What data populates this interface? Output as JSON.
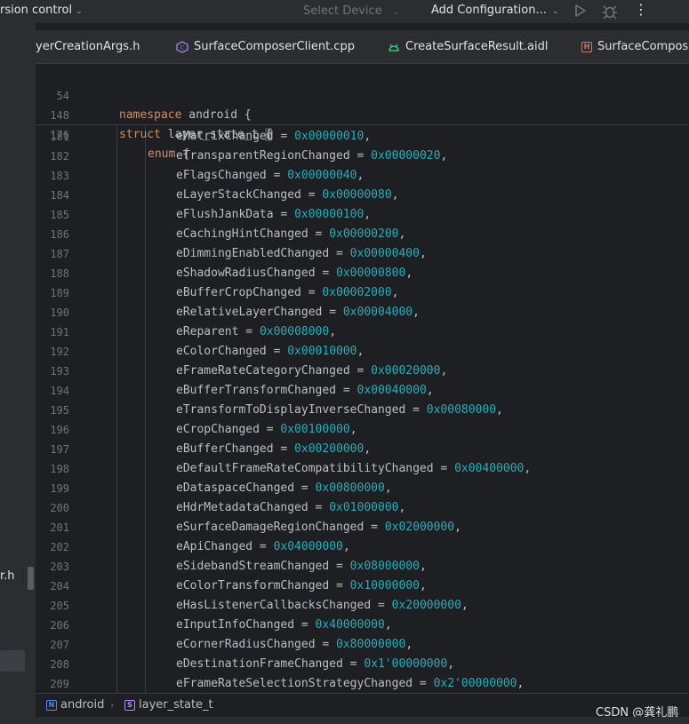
{
  "toolbar": {
    "version_control": "rsion control",
    "select_device": "Select Device",
    "add_configuration": "Add Configuration..."
  },
  "left_panel": {
    "file_fragment": "r.h"
  },
  "tabs": [
    {
      "label": "yerCreationArgs.h"
    },
    {
      "label": "SurfaceComposerClient.cpp"
    },
    {
      "label": "CreateSurfaceResult.aidl"
    },
    {
      "label": "SurfaceCompose"
    }
  ],
  "sticky": [
    {
      "line": "54",
      "kw": "namespace",
      "rest": " android {"
    },
    {
      "line": "148",
      "kw": "struct",
      "rest": " layer_state_t "
    },
    {
      "line": "176",
      "kw": "enum",
      "rest": " "
    }
  ],
  "code_lines": [
    {
      "line": "181",
      "name": "eMatrixChanged",
      "value": "0x00000010"
    },
    {
      "line": "182",
      "name": "eTransparentRegionChanged",
      "value": "0x00000020"
    },
    {
      "line": "183",
      "name": "eFlagsChanged",
      "value": "0x00000040"
    },
    {
      "line": "184",
      "name": "eLayerStackChanged",
      "value": "0x00000080"
    },
    {
      "line": "185",
      "name": "eFlushJankData",
      "value": "0x00000100"
    },
    {
      "line": "186",
      "name": "eCachingHintChanged",
      "value": "0x00000200"
    },
    {
      "line": "187",
      "name": "eDimmingEnabledChanged",
      "value": "0x00000400"
    },
    {
      "line": "188",
      "name": "eShadowRadiusChanged",
      "value": "0x00000800"
    },
    {
      "line": "189",
      "name": "eBufferCropChanged",
      "value": "0x00002000"
    },
    {
      "line": "190",
      "name": "eRelativeLayerChanged",
      "value": "0x00004000"
    },
    {
      "line": "191",
      "name": "eReparent",
      "value": "0x00008000"
    },
    {
      "line": "192",
      "name": "eColorChanged",
      "value": "0x00010000"
    },
    {
      "line": "193",
      "name": "eFrameRateCategoryChanged",
      "value": "0x00020000"
    },
    {
      "line": "194",
      "name": "eBufferTransformChanged",
      "value": "0x00040000"
    },
    {
      "line": "195",
      "name": "eTransformToDisplayInverseChanged",
      "value": "0x00080000"
    },
    {
      "line": "196",
      "name": "eCropChanged",
      "value": "0x00100000"
    },
    {
      "line": "197",
      "name": "eBufferChanged",
      "value": "0x00200000"
    },
    {
      "line": "198",
      "name": "eDefaultFrameRateCompatibilityChanged",
      "value": "0x00400000"
    },
    {
      "line": "199",
      "name": "eDataspaceChanged",
      "value": "0x00800000"
    },
    {
      "line": "200",
      "name": "eHdrMetadataChanged",
      "value": "0x01000000"
    },
    {
      "line": "201",
      "name": "eSurfaceDamageRegionChanged",
      "value": "0x02000000"
    },
    {
      "line": "202",
      "name": "eApiChanged",
      "value": "0x04000000"
    },
    {
      "line": "203",
      "name": "eSidebandStreamChanged",
      "value": "0x08000000"
    },
    {
      "line": "204",
      "name": "eColorTransformChanged",
      "value": "0x10000000"
    },
    {
      "line": "205",
      "name": "eHasListenerCallbacksChanged",
      "value": "0x20000000"
    },
    {
      "line": "206",
      "name": "eInputInfoChanged",
      "value": "0x40000000"
    },
    {
      "line": "207",
      "name": "eCornerRadiusChanged",
      "value": "0x80000000"
    },
    {
      "line": "208",
      "name": "eDestinationFrameChanged",
      "value": "0x1'00000000"
    },
    {
      "line": "209",
      "name": "eFrameRateSelectionStrategyChanged",
      "value": "0x2'00000000"
    }
  ],
  "breadcrumb": {
    "namespace": "android",
    "struct": "layer_state_t",
    "namespace_icon": "N",
    "struct_icon": "S"
  },
  "watermark": "CSDN @龚礼鹏",
  "colors": {
    "keyword": "#cf8e6d",
    "number": "#2aacb8",
    "text": "#bcbec4",
    "background": "#1e1f22",
    "panel": "#2b2d30"
  }
}
